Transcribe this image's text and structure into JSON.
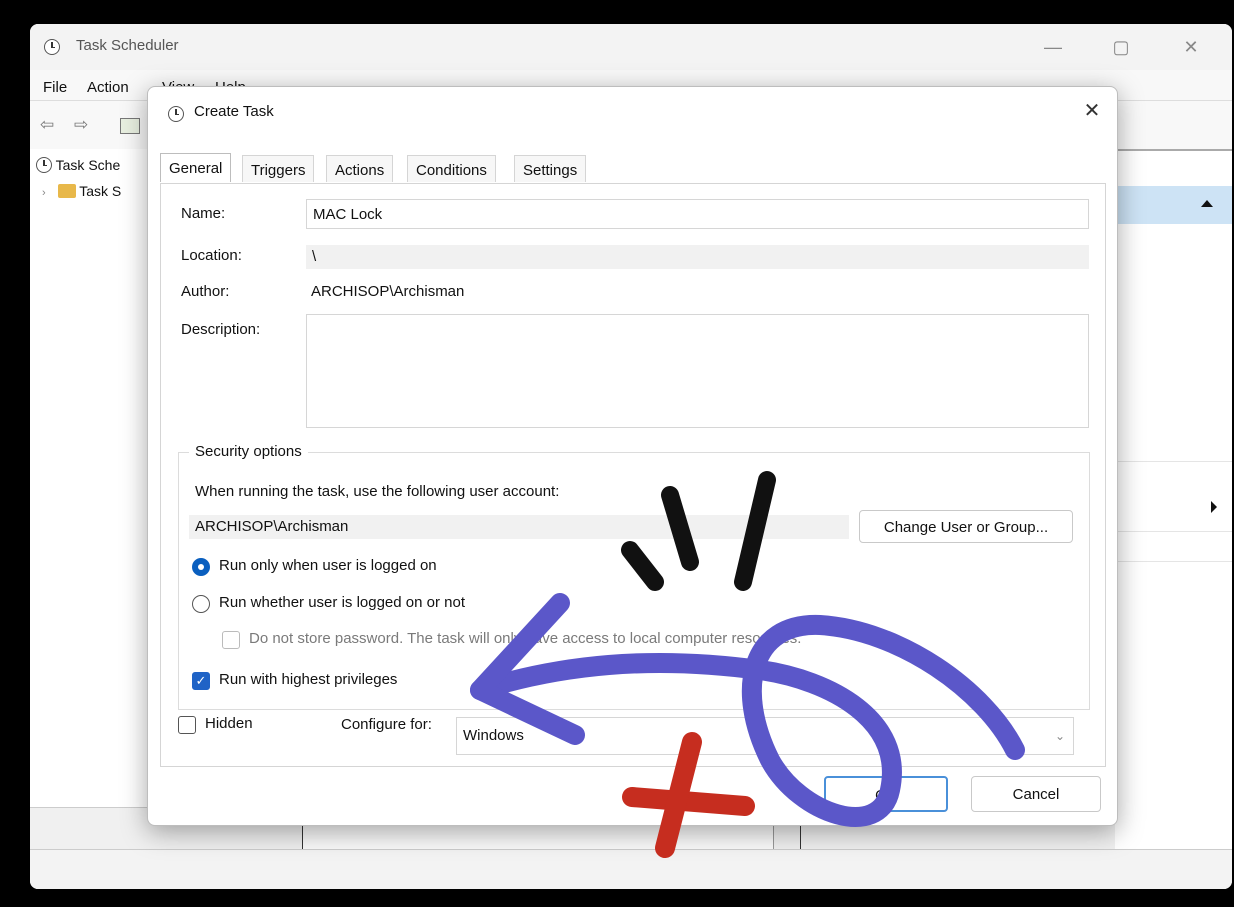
{
  "main_window": {
    "title": "Task Scheduler",
    "menu": [
      "File",
      "Action",
      "View",
      "Help"
    ],
    "tree": [
      "Task Sche",
      "Task S"
    ],
    "controls": {
      "minimize": "—",
      "maximize": "▢",
      "close": "✕"
    }
  },
  "dialog": {
    "title": "Create Task",
    "close": "✕",
    "tabs": [
      "General",
      "Triggers",
      "Actions",
      "Conditions",
      "Settings"
    ],
    "active_tab": "General",
    "general": {
      "name_label": "Name:",
      "name_value": "MAC Lock",
      "location_label": "Location:",
      "location_value": "\\",
      "author_label": "Author:",
      "author_value": "ARCHISOP\\Archisman",
      "description_label": "Description:",
      "description_value": ""
    },
    "security": {
      "legend": "Security options",
      "account_prompt": "When running the task, use the following user account:",
      "account_value": "ARCHISOP\\Archisman",
      "change_button": "Change User or Group...",
      "radio_logged_on": "Run only when user is logged on",
      "radio_whether": "Run whether user is logged on or not",
      "no_store_password": "Do not store password.  The task will only have access to local computer resources.",
      "highest_privileges": "Run with highest privileges",
      "selected_radio": "Run only when user is logged on",
      "highest_privileges_checked": true,
      "no_store_password_checked": false
    },
    "hidden_label": "Hidden",
    "hidden_checked": false,
    "configure_label": "Configure for:",
    "configure_value": "Windows",
    "ok_button": "OK",
    "cancel_button": "Cancel"
  },
  "annotation_colors": {
    "arrow": "#5b57c9",
    "cross": "#c62d1f",
    "marks": "#111111"
  }
}
